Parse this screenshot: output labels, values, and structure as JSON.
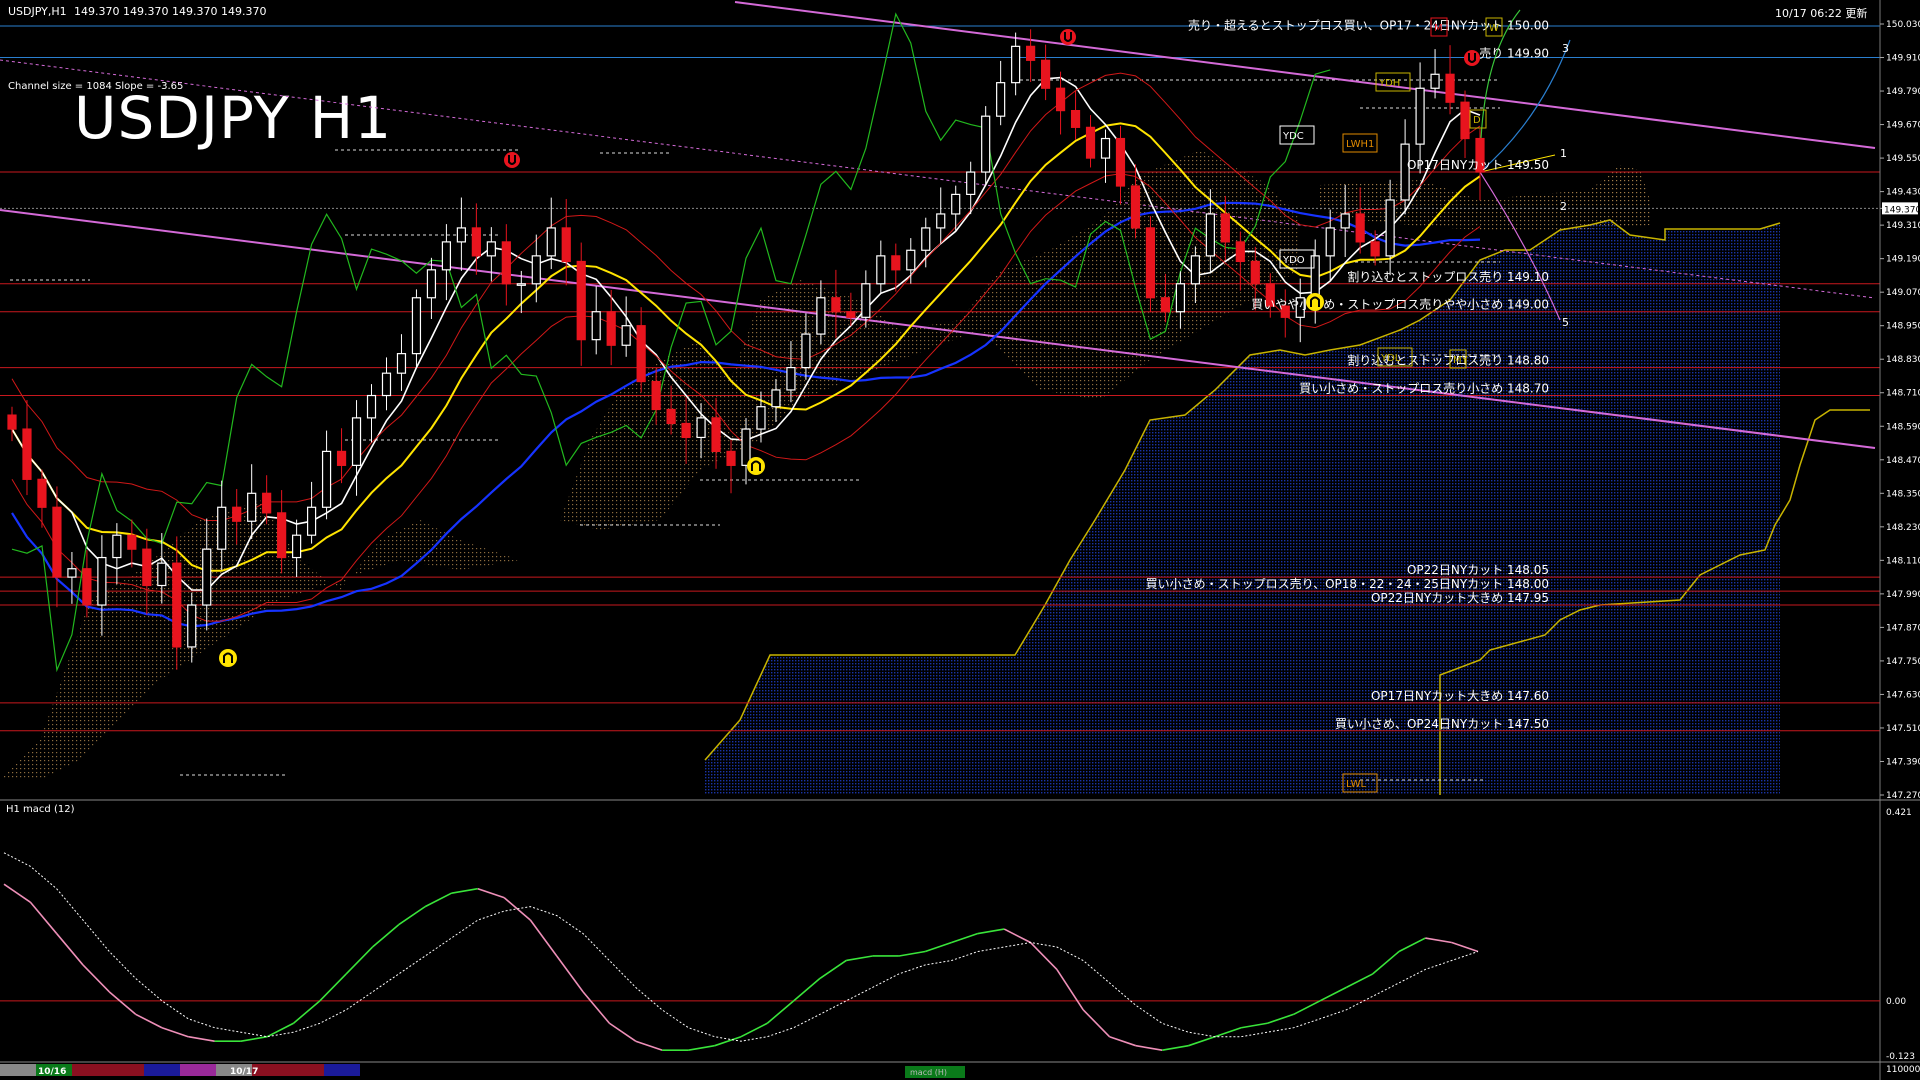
{
  "header": {
    "symbol": "USDJPY,H1",
    "ohlc": "149.370 149.370 149.370 149.370",
    "timestamp": "10/17 06:22 更新",
    "chart_title": "USDJPY H1",
    "channel_info": "Channel size = 1084 Slope = -3.65",
    "macd_label": "H1  macd (12)"
  },
  "colors": {
    "background": "#000000",
    "candle_up": "#ffffff",
    "candle_down": "#e8141e",
    "level_line": "#c8181e",
    "round_line": "#2a7fd0",
    "channel": "#d46ad8",
    "ma_short": "#ffffff",
    "ma_mid": "#ffe400",
    "ma_long": "#1633ff",
    "envelope": "#d01818",
    "chikou": "#22b81e",
    "cloud_upper": "#c8b400",
    "cloud_fill": "#1a36b0",
    "macd_up": "#39e43a",
    "macd_down": "#ee8fb8",
    "signal": "#ffffff"
  },
  "chart_data": {
    "type": "candlestick",
    "instrument": "USDJPY",
    "timeframe": "H1",
    "current_price": 149.37,
    "price_axis": {
      "ylim": [
        147.27,
        150.03
      ],
      "ticks": [
        "150.030",
        "149.910",
        "149.790",
        "149.670",
        "149.550",
        "149.430",
        "149.370",
        "149.310",
        "149.190",
        "149.070",
        "148.950",
        "148.830",
        "148.710",
        "148.590",
        "148.470",
        "148.350",
        "148.230",
        "148.110",
        "147.990",
        "147.870",
        "147.750",
        "147.630",
        "147.510",
        "147.390",
        "147.270"
      ]
    },
    "closes": [
      148.58,
      148.4,
      148.3,
      148.05,
      148.08,
      147.95,
      148.12,
      148.2,
      148.15,
      148.02,
      148.1,
      147.8,
      147.95,
      148.15,
      148.3,
      148.25,
      148.35,
      148.28,
      148.12,
      148.2,
      148.3,
      148.5,
      148.45,
      148.62,
      148.7,
      148.78,
      148.85,
      149.05,
      149.15,
      149.25,
      149.3,
      149.2,
      149.25,
      149.1,
      149.1,
      149.2,
      149.3,
      149.18,
      148.9,
      149.0,
      148.88,
      148.95,
      148.75,
      148.65,
      148.6,
      148.55,
      148.62,
      148.5,
      148.45,
      148.58,
      148.66,
      148.72,
      148.8,
      148.92,
      149.05,
      149.0,
      148.98,
      149.1,
      149.2,
      149.15,
      149.22,
      149.3,
      149.35,
      149.42,
      149.5,
      149.7,
      149.82,
      149.95,
      149.9,
      149.8,
      149.72,
      149.66,
      149.55,
      149.62,
      149.45,
      149.3,
      149.05,
      149.0,
      149.1,
      149.2,
      149.35,
      149.25,
      149.18,
      149.1,
      149.02,
      148.98,
      149.05,
      149.2,
      149.3,
      149.35,
      149.25,
      149.2,
      149.4,
      149.6,
      149.8,
      149.85,
      149.75,
      149.62,
      149.5
    ],
    "levels": [
      {
        "price": 150.0,
        "label": "売り・超えるとストップロス買い、OP17・24日NYカット 150.00"
      },
      {
        "price": 149.9,
        "label": "売り 149.90"
      },
      {
        "price": 149.5,
        "label": "OP17日NYカット 149.50"
      },
      {
        "price": 149.1,
        "label": "割り込むとストップロス売り 149.10"
      },
      {
        "price": 149.0,
        "label": "買いやや小さめ・ストップロス売りやや小さめ 149.00"
      },
      {
        "price": 148.8,
        "label": "割り込むとストップロス売り 148.80"
      },
      {
        "price": 148.7,
        "label": "買い小さめ・ストップロス売り小さめ 148.70"
      },
      {
        "price": 148.05,
        "label": "OP22日NYカット 148.05"
      },
      {
        "price": 148.0,
        "label": "買い小さめ・ストップロス売り、OP18・22・24・25日NYカット 148.00"
      },
      {
        "price": 147.95,
        "label": "OP22日NYカット大きめ 147.95"
      },
      {
        "price": 147.6,
        "label": "OP17日NYカット大きめ 147.60"
      },
      {
        "price": 147.5,
        "label": "買い小さめ、OP24日NYカット 147.50"
      }
    ],
    "projection_labels": [
      "1",
      "2",
      "3",
      "5"
    ],
    "markers": [
      "YDH",
      "YDC",
      "LWH1",
      "YDO",
      "YDL",
      "LWL",
      "D",
      "M",
      "W",
      "MY"
    ],
    "macd": {
      "label": "H1  macd (12)",
      "ylim": [
        -0.123,
        0.421
      ],
      "ticks": [
        "0.421",
        "0.00",
        "-0.123"
      ],
      "line": [
        0.26,
        0.22,
        0.15,
        0.08,
        0.02,
        -0.03,
        -0.06,
        -0.08,
        -0.09,
        -0.09,
        -0.08,
        -0.05,
        0.0,
        0.06,
        0.12,
        0.17,
        0.21,
        0.24,
        0.25,
        0.23,
        0.18,
        0.1,
        0.02,
        -0.05,
        -0.09,
        -0.11,
        -0.11,
        -0.1,
        -0.08,
        -0.05,
        0.0,
        0.05,
        0.09,
        0.1,
        0.1,
        0.11,
        0.13,
        0.15,
        0.16,
        0.13,
        0.07,
        -0.02,
        -0.08,
        -0.1,
        -0.11,
        -0.1,
        -0.08,
        -0.06,
        -0.05,
        -0.03,
        0.0,
        0.03,
        0.06,
        0.11,
        0.14,
        0.13,
        0.11
      ],
      "signal": [
        0.33,
        0.3,
        0.25,
        0.18,
        0.11,
        0.05,
        0.0,
        -0.04,
        -0.06,
        -0.07,
        -0.08,
        -0.07,
        -0.05,
        -0.02,
        0.02,
        0.06,
        0.1,
        0.14,
        0.18,
        0.2,
        0.21,
        0.19,
        0.15,
        0.09,
        0.03,
        -0.02,
        -0.06,
        -0.08,
        -0.09,
        -0.08,
        -0.06,
        -0.03,
        0.0,
        0.03,
        0.06,
        0.08,
        0.09,
        0.11,
        0.12,
        0.13,
        0.12,
        0.09,
        0.04,
        -0.01,
        -0.05,
        -0.07,
        -0.08,
        -0.08,
        -0.07,
        -0.06,
        -0.04,
        -0.02,
        0.01,
        0.04,
        0.07,
        0.09,
        0.11
      ]
    },
    "time_labels": [
      "10/16",
      "10/17"
    ],
    "footer_tab": "macd (H)",
    "volume_label": "110000"
  }
}
